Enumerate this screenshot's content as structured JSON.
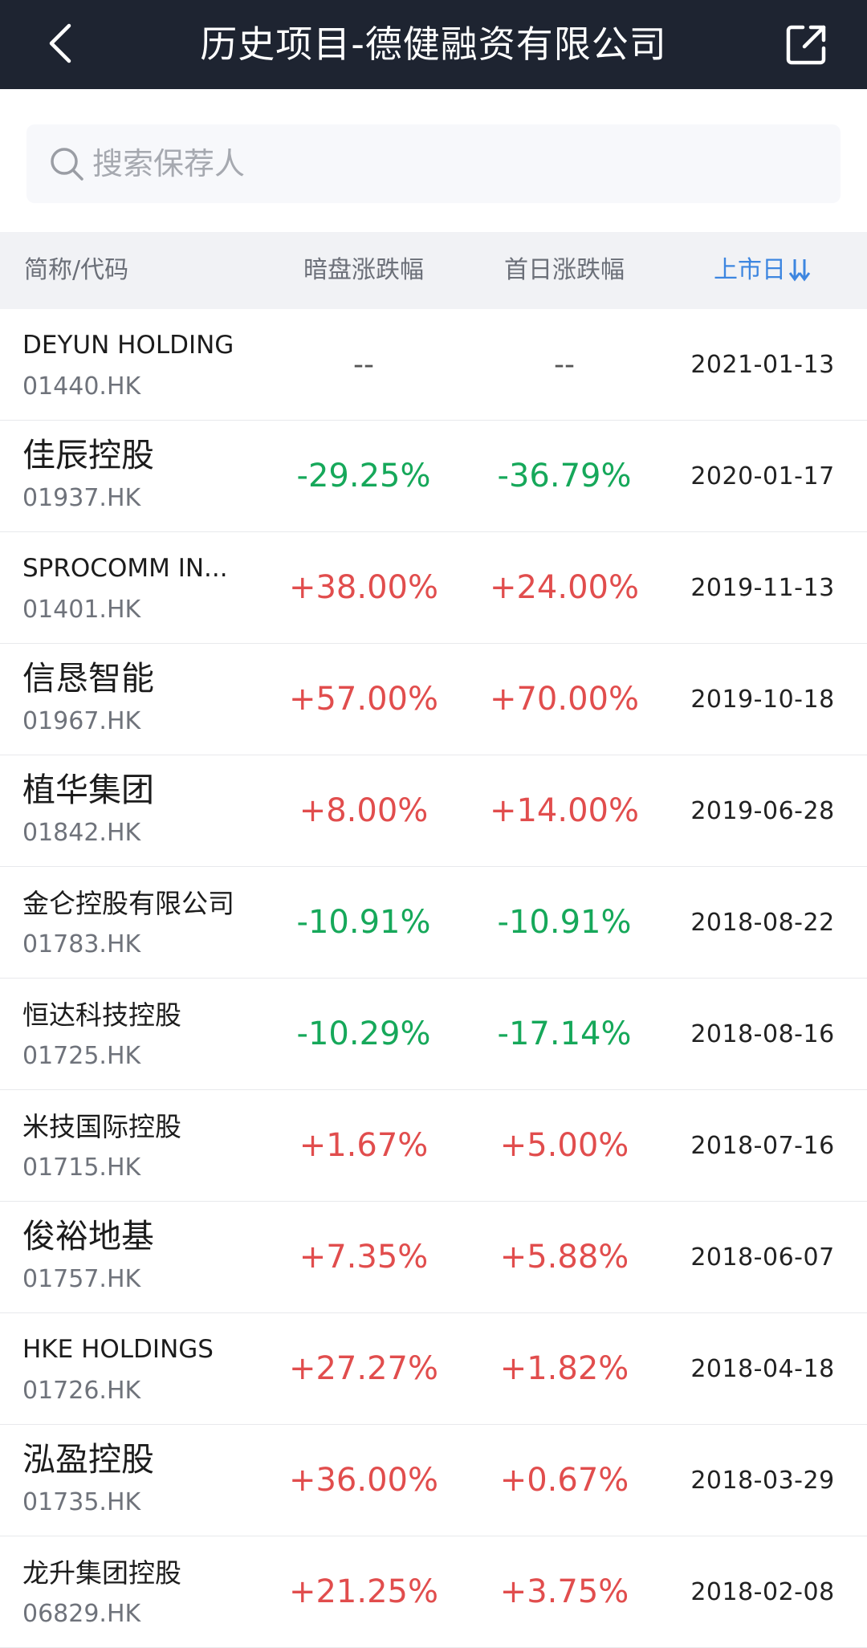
{
  "header": {
    "title": "历史项目-德健融资有限公司",
    "back_icon": "chevron-left-icon",
    "share_icon": "share-icon"
  },
  "search": {
    "placeholder": "搜索保荐人",
    "value": "",
    "icon": "search-icon"
  },
  "columns": {
    "name": "简称/代码",
    "dark_pool": "暗盘涨跌幅",
    "first_day": "首日涨跌幅",
    "listing_date": "上市日",
    "listing_date_sort_icon": "sort-icon"
  },
  "colors": {
    "header_bg": "#1e2431",
    "rise": "#e14d4d",
    "fall": "#16a85a",
    "accent": "#3d86e0"
  },
  "rows": [
    {
      "name": "DEYUN HOLDING",
      "code": "01440.HK",
      "dark": "--",
      "first": "--",
      "date": "2021-01-13",
      "dark_dir": "none",
      "first_dir": "none",
      "name_style": "en"
    },
    {
      "name": "佳辰控股",
      "code": "01937.HK",
      "dark": "-29.25%",
      "first": "-36.79%",
      "date": "2020-01-17",
      "dark_dir": "down",
      "first_dir": "down",
      "name_style": "cn"
    },
    {
      "name": "SPROCOMM IN...",
      "code": "01401.HK",
      "dark": "+38.00%",
      "first": "+24.00%",
      "date": "2019-11-13",
      "dark_dir": "up",
      "first_dir": "up",
      "name_style": "en"
    },
    {
      "name": "信恳智能",
      "code": "01967.HK",
      "dark": "+57.00%",
      "first": "+70.00%",
      "date": "2019-10-18",
      "dark_dir": "up",
      "first_dir": "up",
      "name_style": "cn"
    },
    {
      "name": "植华集团",
      "code": "01842.HK",
      "dark": "+8.00%",
      "first": "+14.00%",
      "date": "2019-06-28",
      "dark_dir": "up",
      "first_dir": "up",
      "name_style": "cn"
    },
    {
      "name": "金仑控股有限公司",
      "code": "01783.HK",
      "dark": "-10.91%",
      "first": "-10.91%",
      "date": "2018-08-22",
      "dark_dir": "down",
      "first_dir": "down",
      "name_style": "cn-small"
    },
    {
      "name": "恒达科技控股",
      "code": "01725.HK",
      "dark": "-10.29%",
      "first": "-17.14%",
      "date": "2018-08-16",
      "dark_dir": "down",
      "first_dir": "down",
      "name_style": "cn-small"
    },
    {
      "name": "米技国际控股",
      "code": "01715.HK",
      "dark": "+1.67%",
      "first": "+5.00%",
      "date": "2018-07-16",
      "dark_dir": "up",
      "first_dir": "up",
      "name_style": "cn-small"
    },
    {
      "name": "俊裕地基",
      "code": "01757.HK",
      "dark": "+7.35%",
      "first": "+5.88%",
      "date": "2018-06-07",
      "dark_dir": "up",
      "first_dir": "up",
      "name_style": "cn"
    },
    {
      "name": "HKE HOLDINGS",
      "code": "01726.HK",
      "dark": "+27.27%",
      "first": "+1.82%",
      "date": "2018-04-18",
      "dark_dir": "up",
      "first_dir": "up",
      "name_style": "en"
    },
    {
      "name": "泓盈控股",
      "code": "01735.HK",
      "dark": "+36.00%",
      "first": "+0.67%",
      "date": "2018-03-29",
      "dark_dir": "up",
      "first_dir": "up",
      "name_style": "cn"
    },
    {
      "name": "龙升集团控股",
      "code": "06829.HK",
      "dark": "+21.25%",
      "first": "+3.75%",
      "date": "2018-02-08",
      "dark_dir": "up",
      "first_dir": "up",
      "name_style": "cn-small"
    }
  ]
}
